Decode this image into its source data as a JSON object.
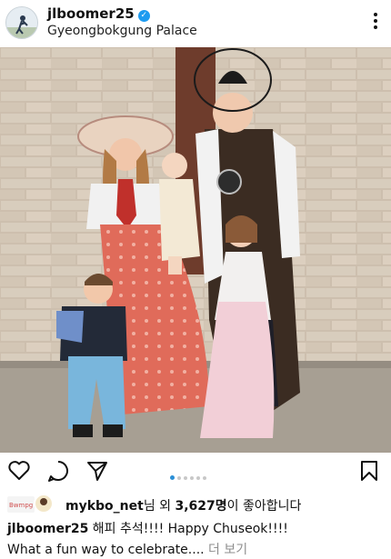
{
  "post": {
    "username": "jlboomer25",
    "location": "Gyeongbokgung Palace",
    "verified": true
  },
  "photo": {
    "description_icon": "family-photo"
  },
  "actions": {
    "icons": [
      "heart-icon",
      "comment-icon",
      "send-icon",
      "bookmark-icon"
    ]
  },
  "carousel": {
    "count": 6,
    "active_index": 0
  },
  "likes": {
    "liker": "mykbo_net",
    "mid": "님 외 ",
    "count": "3,627명",
    "tail": "이 좋아합니다"
  },
  "caption": {
    "username": "jlboomer25",
    "text": " 해피 추석!!!! Happy Chuseok!!!!",
    "line2": "What a fun way to celebrate.... ",
    "more": "더 보기"
  },
  "colors": {
    "accent": "#2b8fd6",
    "verified": "#1d9bf0"
  }
}
